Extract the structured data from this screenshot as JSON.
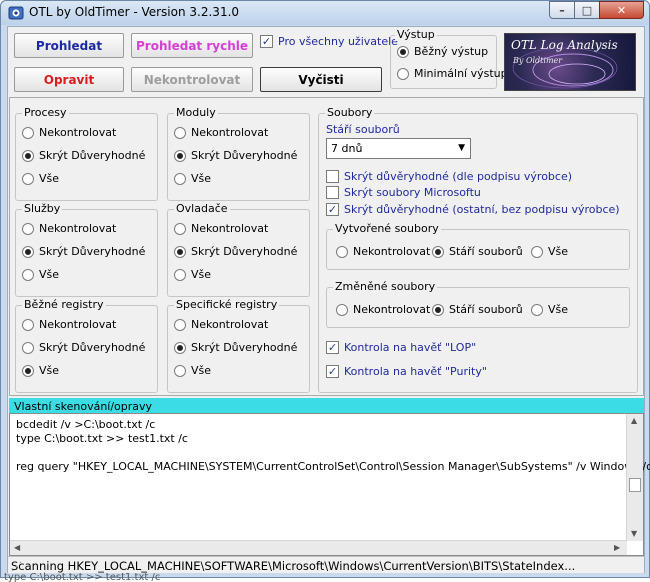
{
  "window": {
    "title": "OTL by OldTimer - Version 3.2.31.0",
    "minimize_glyph": "–",
    "maximize_glyph": "□",
    "close_glyph": "✕"
  },
  "toolbar": {
    "scan_label": "Prohledat",
    "quick_scan_label": "Prohledat rychle",
    "fix_label": "Opravit",
    "none_label": "Nekontrolovat",
    "clear_label": "Vyčisti",
    "all_users_label": "Pro všechny uživatele",
    "all_users_checked": true
  },
  "output": {
    "label": "Výstup",
    "options": [
      "Běžný výstup",
      "Minimální výstup"
    ],
    "selected": 0
  },
  "logo": {
    "title": "OTL Log Analysis",
    "subtitle": "By Oldtimer"
  },
  "option_labels": [
    "Nekontrolovat",
    "Skrýt Důveryhodné",
    "Vše"
  ],
  "groups": {
    "procesy": {
      "label": "Procesy",
      "selected": 1
    },
    "moduly": {
      "label": "Moduly",
      "selected": 1
    },
    "sluzby": {
      "label": "Služby",
      "selected": 1
    },
    "ovladace": {
      "label": "Ovladače",
      "selected": 1
    },
    "bezne_registry": {
      "label": "Běžné registry",
      "selected": 2
    },
    "specificke_registry": {
      "label": "Specifické registry",
      "selected": 1
    }
  },
  "soubory": {
    "label": "Soubory",
    "age_label": "Stáří souborů",
    "age_value": "7 dnů",
    "checks": [
      {
        "label": "Skrýt důvěryhodné (dle podpisu výrobce)",
        "checked": false
      },
      {
        "label": "Skrýt soubory Microsoftu",
        "checked": false
      },
      {
        "label": "Skrýt důvěryhodné (ostatní, bez podpisu výrobce)",
        "checked": true
      }
    ],
    "created": {
      "label": "Vytvořené soubory",
      "options": [
        "Nekontrolovat",
        "Stáří souborů",
        "Vše"
      ],
      "selected": 1
    },
    "changed": {
      "label": "Změněné soubory",
      "options": [
        "Nekontrolovat",
        "Stáří souborů",
        "Vše"
      ],
      "selected": 1
    },
    "lop_label": "Kontrola na havěť \"LOP\"",
    "lop_checked": true,
    "purity_label": "Kontrola na havěť \"Purity\"",
    "purity_checked": true
  },
  "custom": {
    "label": "Vlastní skenování/opravy",
    "lines": [
      "bcdedit /v >C:\\boot.txt /c",
      "type C:\\boot.txt >> test1.txt /c",
      "",
      "reg query \"HKEY_LOCAL_MACHINE\\SYSTEM\\CurrentControlSet\\Control\\Session Manager\\SubSystems\" /v Windows /c"
    ]
  },
  "status": {
    "text": "Scanning HKEY_LOCAL_MACHINE\\SOFTWARE\\Microsoft\\Windows\\CurrentVersion\\BITS\\StateIndex..."
  },
  "background_text": "type C:\\boot.txt >> test1.txt /c",
  "icons": {
    "app": "otl-app-icon",
    "check": "✓",
    "dropdown": "▼",
    "scroll_up": "▲",
    "scroll_down": "▼",
    "scroll_left": "◀",
    "scroll_right": "▶",
    "grip": "⋰"
  }
}
